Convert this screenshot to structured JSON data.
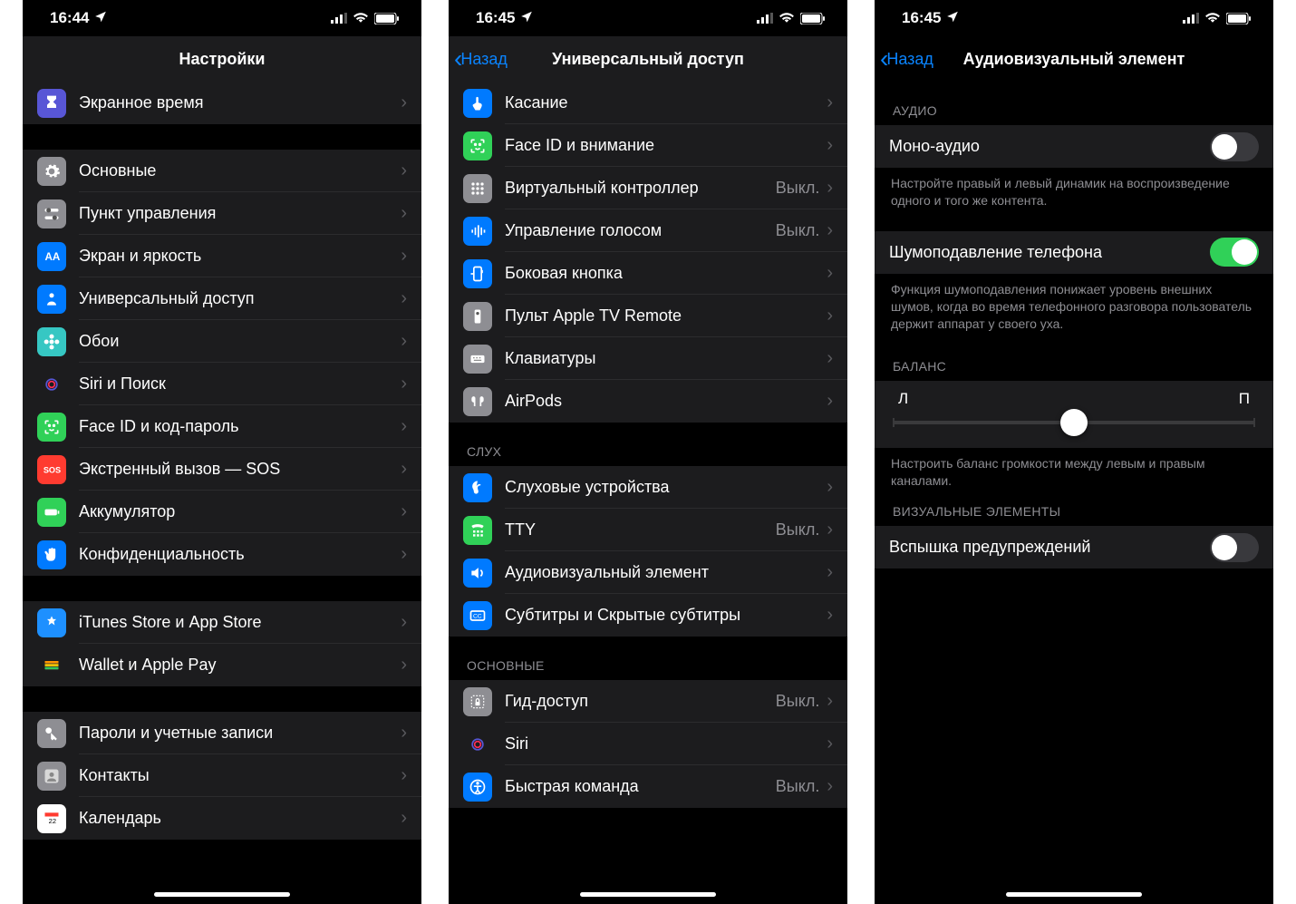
{
  "status": {
    "time1": "16:44",
    "time2": "16:45",
    "time3": "16:45"
  },
  "screen1": {
    "title": "Настройки",
    "rows_top": [
      {
        "label": "Экранное время",
        "color": "#5856d6",
        "icon": "hourglass"
      }
    ],
    "rows_a": [
      {
        "label": "Основные",
        "color": "#8e8e93",
        "icon": "gear"
      },
      {
        "label": "Пункт управления",
        "color": "#8e8e93",
        "icon": "switches"
      },
      {
        "label": "Экран и яркость",
        "color": "#007aff",
        "icon": "AA"
      },
      {
        "label": "Универсальный доступ",
        "color": "#007aff",
        "icon": "person"
      },
      {
        "label": "Обои",
        "color": "#36c7c3",
        "icon": "flower"
      },
      {
        "label": "Siri и Поиск",
        "color": "#1c1c1e",
        "icon": "siri"
      },
      {
        "label": "Face ID и код-пароль",
        "color": "#30d158",
        "icon": "faceid"
      },
      {
        "label": "Экстренный вызов — SOS",
        "color": "#ff3b30",
        "icon": "SOS"
      },
      {
        "label": "Аккумулятор",
        "color": "#30d158",
        "icon": "battery"
      },
      {
        "label": "Конфиденциальность",
        "color": "#007aff",
        "icon": "hand"
      }
    ],
    "rows_b": [
      {
        "label": "iTunes Store и App Store",
        "color": "#1e90ff",
        "icon": "appstore"
      },
      {
        "label": "Wallet и Apple Pay",
        "color": "#1c1c1e",
        "icon": "wallet"
      }
    ],
    "rows_c": [
      {
        "label": "Пароли и учетные записи",
        "color": "#8e8e93",
        "icon": "key"
      },
      {
        "label": "Контакты",
        "color": "#8e8e93",
        "icon": "contacts"
      },
      {
        "label": "Календарь",
        "color": "#ffffff",
        "icon": "calendar"
      }
    ]
  },
  "screen2": {
    "back": "Назад",
    "title": "Универсальный доступ",
    "rows_a": [
      {
        "label": "Касание",
        "color": "#007aff",
        "icon": "touch"
      },
      {
        "label": "Face ID и внимание",
        "color": "#30d158",
        "icon": "faceid"
      },
      {
        "label": "Виртуальный контроллер",
        "color": "#8e8e93",
        "icon": "grid",
        "value": "Выкл."
      },
      {
        "label": "Управление голосом",
        "color": "#007aff",
        "icon": "voice",
        "value": "Выкл."
      },
      {
        "label": "Боковая кнопка",
        "color": "#007aff",
        "icon": "side"
      },
      {
        "label": "Пульт Apple TV Remote",
        "color": "#8e8e93",
        "icon": "remote"
      },
      {
        "label": "Клавиатуры",
        "color": "#8e8e93",
        "icon": "keyboard"
      },
      {
        "label": "AirPods",
        "color": "#8e8e93",
        "icon": "airpods"
      }
    ],
    "header_b": "СЛУХ",
    "rows_b": [
      {
        "label": "Слуховые устройства",
        "color": "#007aff",
        "icon": "ear"
      },
      {
        "label": "TTY",
        "color": "#30d158",
        "icon": "tty",
        "value": "Выкл."
      },
      {
        "label": "Аудиовизуальный элемент",
        "color": "#007aff",
        "icon": "audio"
      },
      {
        "label": "Субтитры и Скрытые субтитры",
        "color": "#007aff",
        "icon": "cc"
      }
    ],
    "header_c": "ОСНОВНЫЕ",
    "rows_c": [
      {
        "label": "Гид-доступ",
        "color": "#8e8e93",
        "icon": "lock",
        "value": "Выкл."
      },
      {
        "label": "Siri",
        "color": "#1c1c1e",
        "icon": "siri"
      },
      {
        "label": "Быстрая команда",
        "color": "#007aff",
        "icon": "access",
        "value": "Выкл."
      }
    ]
  },
  "screen3": {
    "back": "Назад",
    "title": "Аудиовизуальный элемент",
    "header_a": "АУДИО",
    "mono_label": "Моно-аудио",
    "mono_footer": "Настройте правый и левый динамик на воспроизведение одного и того же контента.",
    "noise_label": "Шумоподавление телефона",
    "noise_footer": "Функция шумоподавления понижает уровень внешних шумов, когда во время телефонного разговора пользователь держит аппарат у своего уха.",
    "header_b": "БАЛАНС",
    "balance_left": "Л",
    "balance_right": "П",
    "balance_footer": "Настроить баланс громкости между левым и правым каналами.",
    "header_c": "ВИЗУАЛЬНЫЕ ЭЛЕМЕНТЫ",
    "flash_label": "Вспышка предупреждений"
  }
}
